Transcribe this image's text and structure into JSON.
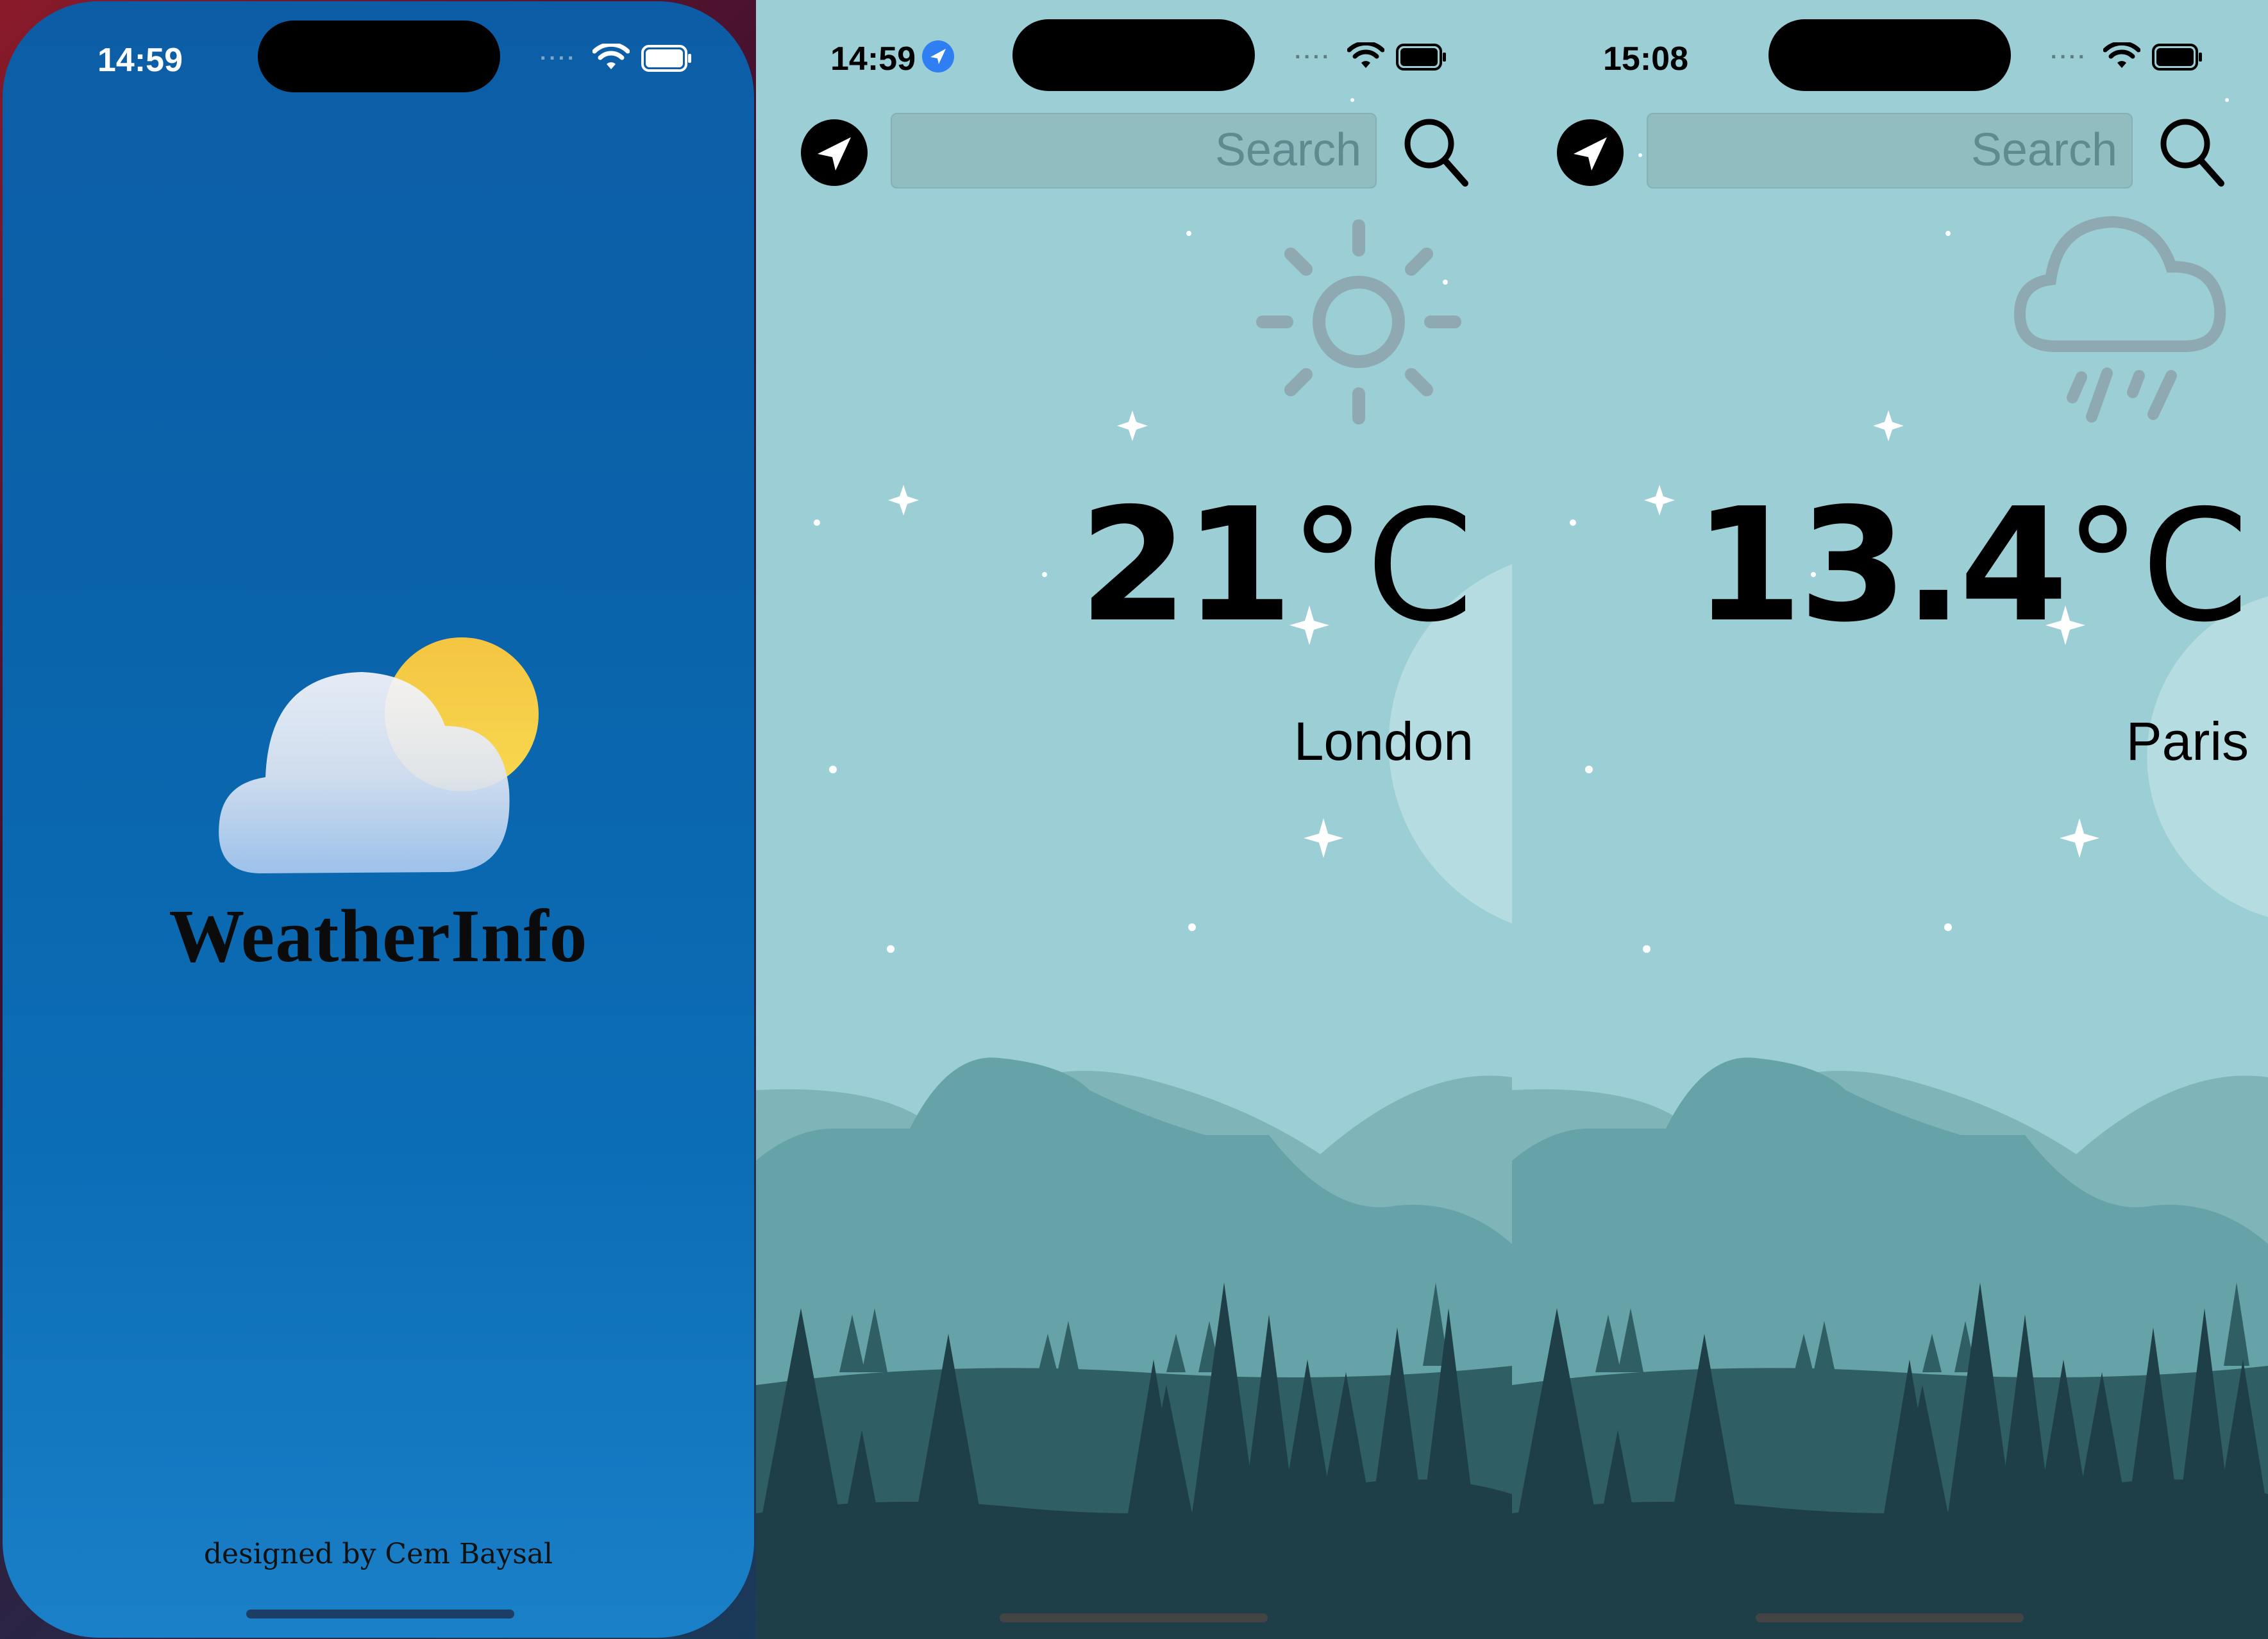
{
  "splash": {
    "status_time": "14:59",
    "app_name": "WeatherInfo",
    "credit": "designed by Cem Baysal",
    "logo_icon": "cloud-sun-icon",
    "background_color": "#0b63aa"
  },
  "screens": [
    {
      "status_time": "14:59",
      "location_indicator_icon": "location-arrow-icon",
      "search": {
        "placeholder": "Search"
      },
      "condition_icon": "sun-icon",
      "temperature": "21",
      "unit": "°C",
      "city": "London"
    },
    {
      "status_time": "15:08",
      "search": {
        "placeholder": "Search"
      },
      "condition_icon": "cloud-rain-icon",
      "temperature": "13.4",
      "unit": "°C",
      "city": "Paris"
    }
  ],
  "colors": {
    "sky": "#9bcfd5",
    "hills_back": "#7fb4b8",
    "hills_mid": "#66a3a9",
    "forest_mid": "#2f5f64",
    "forest_front": "#1e3f47",
    "icon_gray": "#8fa9b3"
  }
}
